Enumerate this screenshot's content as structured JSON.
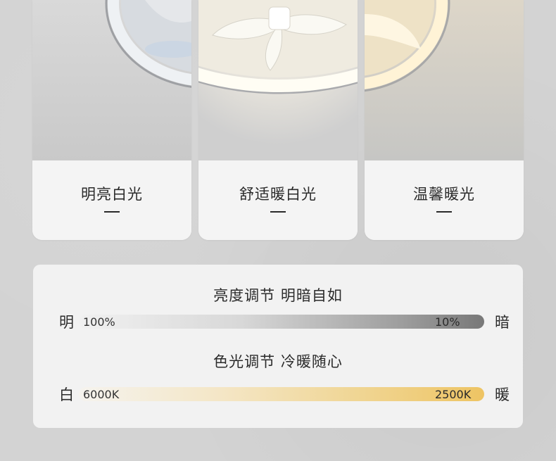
{
  "modes": [
    {
      "label": "明亮白光"
    },
    {
      "label": "舒适暖白光"
    },
    {
      "label": "温馨暖光"
    }
  ],
  "brightness": {
    "title": "亮度调节  明暗自如",
    "left_end": "明",
    "right_end": "暗",
    "start_value": "100%",
    "end_value": "10%"
  },
  "color_temp": {
    "title": "色光调节  冷暖随心",
    "left_end": "白",
    "right_end": "暖",
    "start_value": "6000K",
    "end_value": "2500K"
  },
  "colors": {
    "page_bg": "#d3d3d3",
    "card_bg": "#f4f4f4",
    "text": "#2a2a2a",
    "brightness_bar_dark": "#7a7a7a",
    "color_temp_bar_warm": "#efc462"
  }
}
